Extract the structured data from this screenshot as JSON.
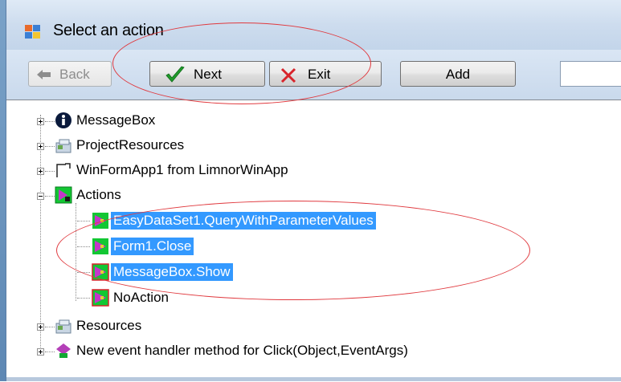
{
  "window": {
    "title": "Select an action"
  },
  "toolbar": {
    "back_label": "Back",
    "next_label": "Next",
    "exit_label": "Exit",
    "add_label": "Add",
    "search_value": ""
  },
  "tree": {
    "items": [
      {
        "label": "MessageBox",
        "icon": "info-icon"
      },
      {
        "label": "ProjectResources",
        "icon": "resources-icon"
      },
      {
        "label": "WinFormApp1 from LimnorWinApp",
        "icon": "form-icon"
      },
      {
        "label": "Actions",
        "icon": "actions-folder-icon"
      },
      {
        "label": "EasyDataSet1.QueryWithParameterValues",
        "icon": "action-icon",
        "selected": true
      },
      {
        "label": "Form1.Close",
        "icon": "action-icon",
        "selected": true
      },
      {
        "label": "MessageBox.Show",
        "icon": "action-icon",
        "selected": true
      },
      {
        "label": "NoAction",
        "icon": "action-icon"
      },
      {
        "label": "Resources",
        "icon": "resources-icon"
      },
      {
        "label": "New event handler method for Click(Object,EventArgs)",
        "icon": "event-handler-icon"
      }
    ]
  },
  "colors": {
    "selection": "#3399ff",
    "annotation": "#e0393e"
  }
}
